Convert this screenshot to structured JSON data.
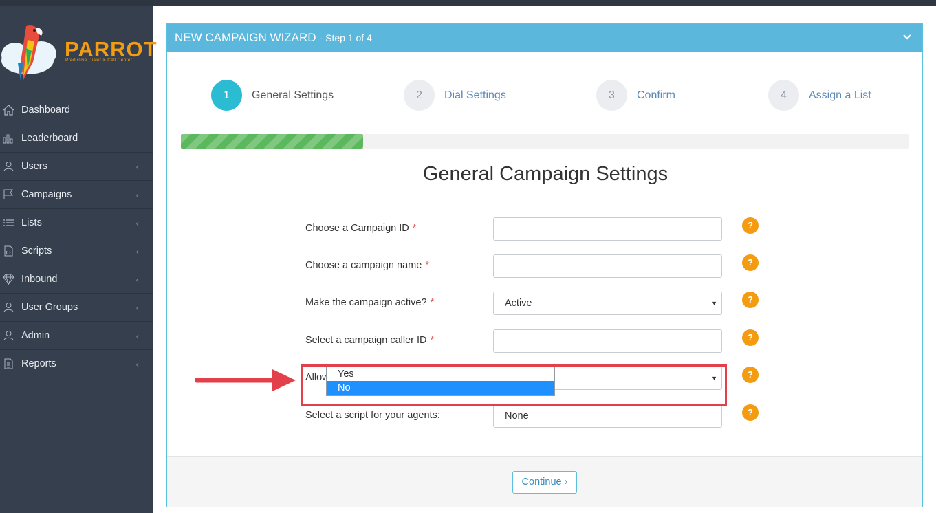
{
  "brand": {
    "name": "PARROT",
    "tagline": "Predictive Dialer & Call Center"
  },
  "sidebar": {
    "items": [
      {
        "label": "Dashboard",
        "icon": "home-icon",
        "has_submenu": false
      },
      {
        "label": "Leaderboard",
        "icon": "bar-chart-icon",
        "has_submenu": false
      },
      {
        "label": "Users",
        "icon": "user-icon",
        "has_submenu": true
      },
      {
        "label": "Campaigns",
        "icon": "flag-icon",
        "has_submenu": true
      },
      {
        "label": "Lists",
        "icon": "list-icon",
        "has_submenu": true
      },
      {
        "label": "Scripts",
        "icon": "script-file-icon",
        "has_submenu": true
      },
      {
        "label": "Inbound",
        "icon": "diamond-icon",
        "has_submenu": true
      },
      {
        "label": "User Groups",
        "icon": "user-group-icon",
        "has_submenu": true
      },
      {
        "label": "Admin",
        "icon": "admin-user-icon",
        "has_submenu": true
      },
      {
        "label": "Reports",
        "icon": "report-file-icon",
        "has_submenu": true
      }
    ]
  },
  "wizard": {
    "title": "NEW CAMPAIGN WIZARD",
    "step_text": "- Step 1 of 4",
    "steps": [
      {
        "number": "1",
        "label": "General Settings",
        "active": true
      },
      {
        "number": "2",
        "label": "Dial Settings",
        "active": false
      },
      {
        "number": "3",
        "label": "Confirm",
        "active": false
      },
      {
        "number": "4",
        "label": "Assign a List",
        "active": false
      }
    ],
    "progress_fraction": 0.25,
    "section_title": "General Campaign Settings",
    "fields": [
      {
        "label": "Choose a Campaign ID",
        "required": true,
        "type": "text",
        "value": ""
      },
      {
        "label": "Choose a campaign name",
        "required": true,
        "type": "text",
        "value": ""
      },
      {
        "label": "Make the campaign active?",
        "required": true,
        "type": "select",
        "value": "Active"
      },
      {
        "label": "Select a campaign caller ID",
        "required": true,
        "type": "text",
        "value": ""
      },
      {
        "label": "Allow inbound calling?",
        "required": false,
        "type": "select",
        "value": "No"
      },
      {
        "label": "Select a script for your agents:",
        "required": false,
        "type": "select",
        "value": "None"
      }
    ],
    "help_symbol": "?",
    "required_mark": "*",
    "dropdown_open": {
      "options": [
        "Yes",
        "No"
      ],
      "selected": "No"
    },
    "continue_label": "Continue ›"
  },
  "colors": {
    "sidebar_bg": "#353f4d",
    "panel_header": "#5bb8dc",
    "active_step": "#2bbcd4",
    "progress": "#5cb85c",
    "help_badge": "#f39c12",
    "annotation": "#e2404a"
  }
}
